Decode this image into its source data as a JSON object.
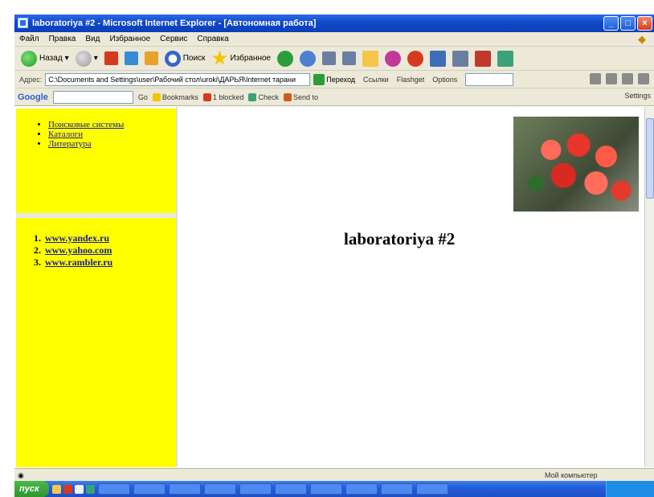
{
  "window": {
    "title": "laboratoriya #2 - Microsoft Internet Explorer - [Автономная работа]"
  },
  "menu": [
    "Файл",
    "Правка",
    "Вид",
    "Избранное",
    "Сервис",
    "Справка"
  ],
  "toolbar": {
    "back_label": "Назад",
    "search_label": "Поиск",
    "favorites_label": "Избранное"
  },
  "address": {
    "label": "Адрес:",
    "value": "C:\\Documents and Settings\\user\\Рабочий стол\\uroki\\ДАРЬЯ\\Internet тарани",
    "go_label": "Переход",
    "links_label": "Ссылки",
    "extra1": "Flashget",
    "extra2": "Options"
  },
  "google": {
    "logo": "Google",
    "go": "Go",
    "bookmarks": "Bookmarks",
    "blocked": "1 blocked",
    "check": "Check",
    "sendto": "Send to",
    "settings": "Settings"
  },
  "nav": {
    "links": [
      "Поисковые системы",
      "Каталоги",
      "Литература"
    ],
    "sites": [
      "www.yandex.ru",
      "www.yahoo.com",
      "www.rambler.ru"
    ]
  },
  "main": {
    "heading": "laboratoriya #2"
  },
  "status": {
    "zone": "Мой компьютер"
  },
  "taskbar": {
    "start_label": "пуск"
  },
  "colors": {
    "frame_bg": "#ffff00",
    "link": "#1a1aa6"
  }
}
